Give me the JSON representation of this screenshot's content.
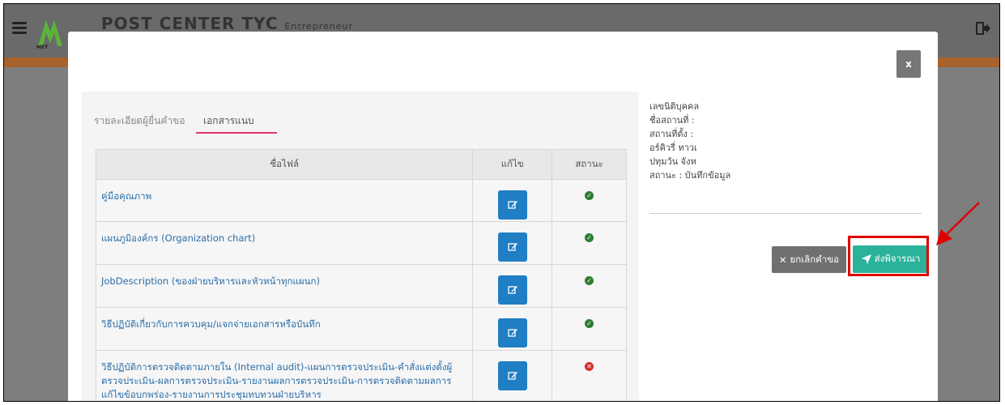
{
  "app": {
    "title": "POST CENTER TYC",
    "title_suffix": "Entrepreneur",
    "logo_text": "MET"
  },
  "modal": {
    "close_label": "x",
    "tabs": [
      {
        "label": "รายละเอียดผู้ยื่นคำขอ"
      },
      {
        "label": "เอกสารแนบ"
      }
    ],
    "table": {
      "headers": [
        "ชื่อไฟล์",
        "แก้ไข",
        "สถานะ"
      ],
      "rows": [
        {
          "name": "คู่มือคุณภาพ",
          "status": "ok"
        },
        {
          "name": "แผนภูมิองค์กร (Organization chart)",
          "status": "ok"
        },
        {
          "name": "JobDescription (ของฝ่ายบริหารและหัวหน้าทุกแผนก)",
          "status": "ok"
        },
        {
          "name": "วิธีปฏิบัติเกี่ยวกับการควบคุม/แจกจ่ายเอกสารหรือบันทึก",
          "status": "ok"
        },
        {
          "name": "วิธีปฏิบัติการตรวจติดตามภายใน (Internal audit)-แผนการตรวจประเมิน-คำสั่งแต่งตั้งผู้ตรวจประเมิน-ผลการตรวจประเมิน-รายงานผลการตรวจประเมิน-การตรวจติดตามผลการแก้ไขข้อบกพร่อง-รายงานการประชุมทบทวนฝ่ายบริหาร",
          "status": "error"
        }
      ]
    },
    "info": {
      "line1": "เลขนิติบุคคล",
      "line2": "ชื่อสถานที่ : ",
      "line3": "สถานที่ตั้ง : ",
      "line4": "อร์คิวรี่ ทาวเ",
      "line5": "ปทุมวัน จังห",
      "line6": "สถานะ : บันทึกข้อมูล"
    },
    "buttons": {
      "cancel_label": "ยกเลิกคำขอ",
      "submit_label": "ส่งพิจารณา"
    }
  },
  "colors": {
    "submit": "#2ab39a",
    "cancel": "#707070",
    "edit": "#1f7ec4",
    "highlight": "#e00000"
  }
}
